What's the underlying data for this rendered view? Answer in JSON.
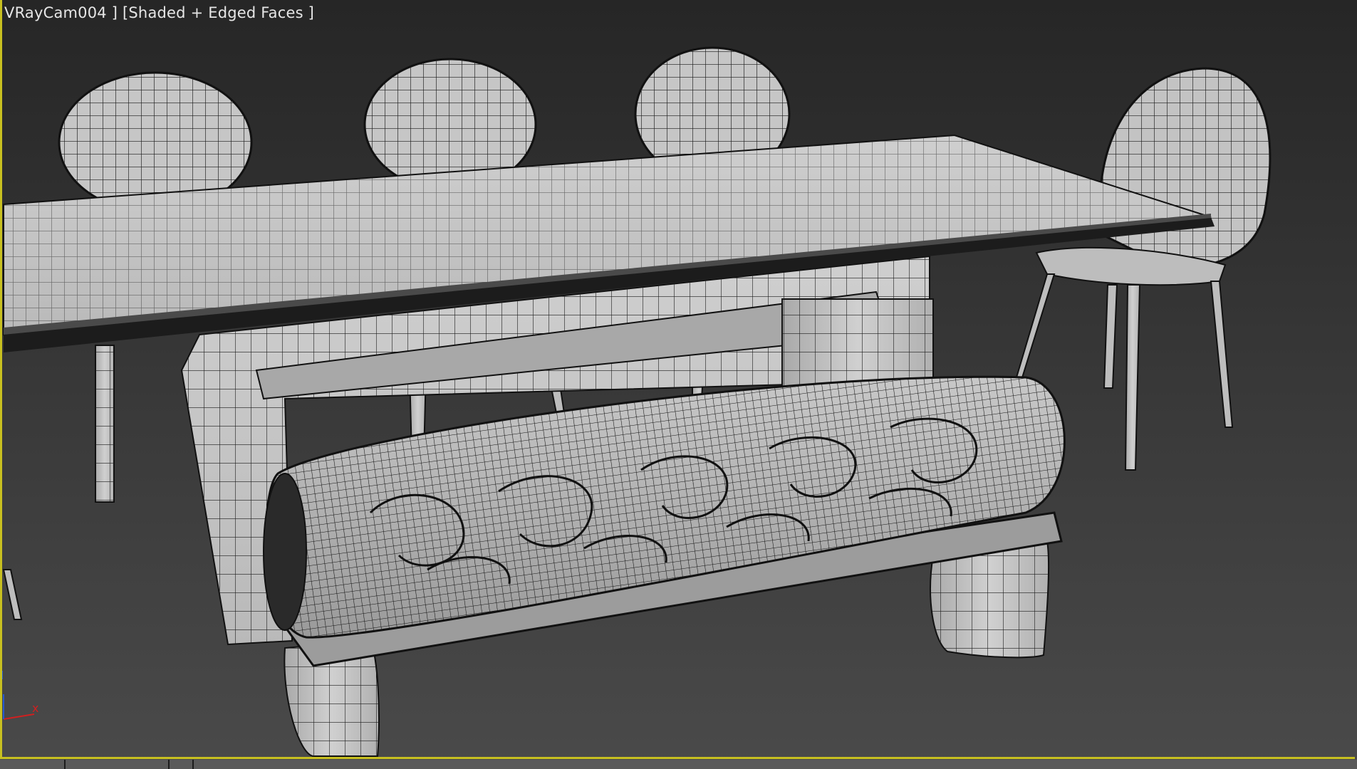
{
  "viewport": {
    "label": "VRayCam004 ] [Shaded + Edged Faces ]",
    "camera": "VRayCam004",
    "shading_mode": "Shaded + Edged Faces"
  },
  "axis_gizmo": {
    "x_label": "x"
  },
  "colors": {
    "background_top": "#262626",
    "background_bottom": "#4a4a4a",
    "active_viewport_border": "#c8c020",
    "mesh_fill": "#c4c4c4",
    "wire": "#1a1a1a",
    "axis_x": "#d02020",
    "axis_y": "#2a5ad0"
  }
}
